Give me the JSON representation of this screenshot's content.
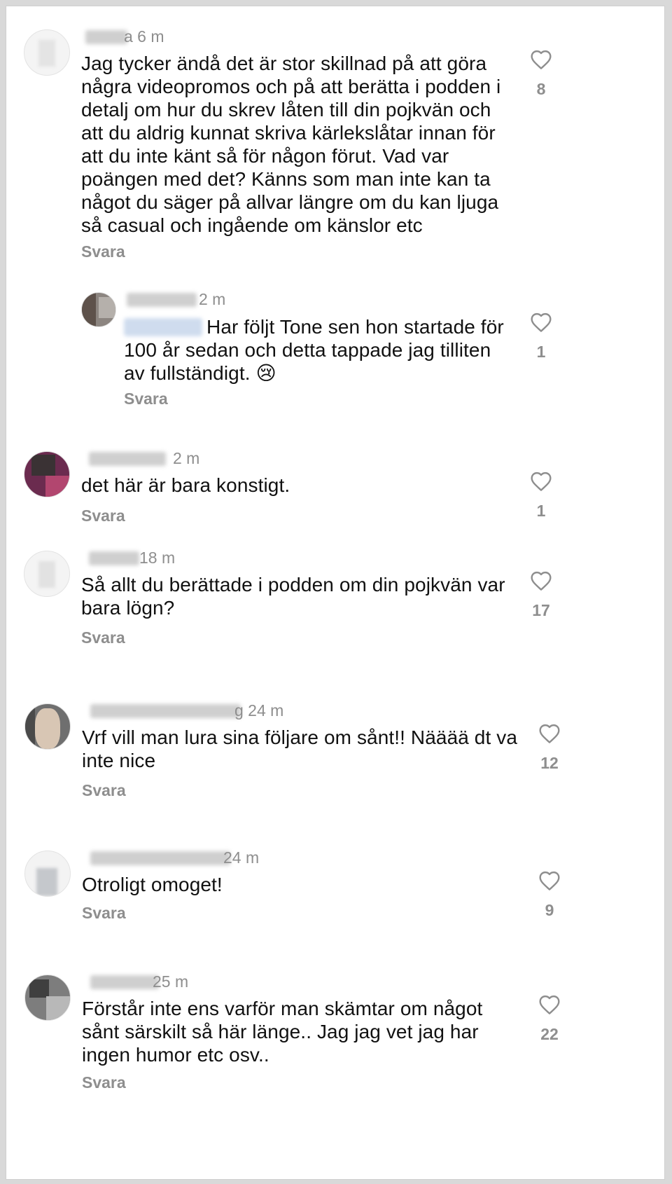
{
  "icons": {
    "like": "heart-outline-icon"
  },
  "colors": {
    "text": "#111111",
    "meta": "#8e8e8e",
    "background": "#ffffff"
  },
  "comments": [
    {
      "time": "a 6 m",
      "text": "Jag tycker ändå det är stor skillnad på att göra några videopromos och på att berätta i podden i detalj om hur du skrev låten till din pojkvän och att du aldrig kunnat skriva kärlekslåtar innan för att du inte känt så för någon förut. Vad var poängen med det? Känns som man inte kan ta något du säger på allvar längre om du kan ljuga så casual och ingående om känslor etc",
      "reply_label": "Svara",
      "likes": "8"
    },
    {
      "time": "2 m",
      "text": "Har följt Tone sen hon startade för 100 år sedan och detta tappade jag tilliten av fullständigt. 😢",
      "reply_label": "Svara",
      "likes": "1"
    },
    {
      "time": "2 m",
      "text": "det här är bara konstigt.",
      "reply_label": "Svara",
      "likes": "1"
    },
    {
      "time": "18 m",
      "text": "Så allt du berättade i podden om din pojkvän var bara lögn?",
      "reply_label": "Svara",
      "likes": "17"
    },
    {
      "time": "g 24 m",
      "text": "Vrf vill man lura sina följare om sånt!! Nääää dt va inte nice",
      "reply_label": "Svara",
      "likes": "12"
    },
    {
      "time": "24 m",
      "text": "Otroligt omoget!",
      "reply_label": "Svara",
      "likes": "9"
    },
    {
      "time": "25 m",
      "text": "Förstår inte ens varför man skämtar om något sånt särskilt så här länge.. Jag jag vet jag har ingen humor etc osv..",
      "reply_label": "Svara",
      "likes": "22"
    }
  ]
}
